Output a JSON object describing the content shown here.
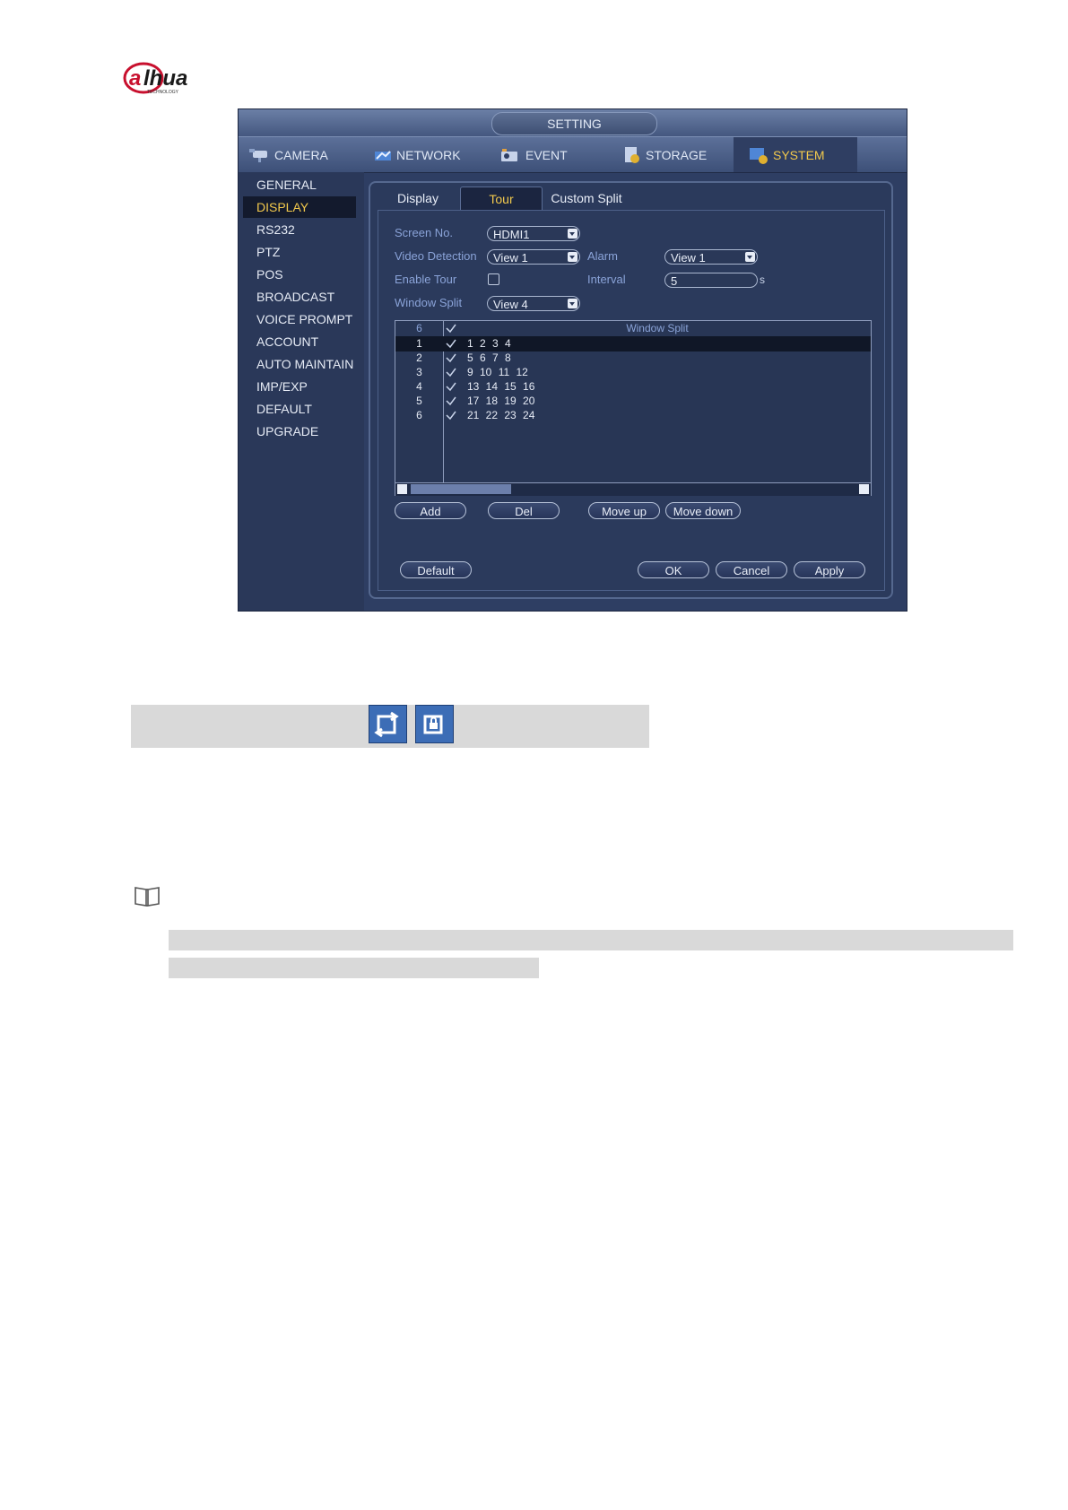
{
  "brand": {
    "name": "alhua",
    "tagline": "TECHNOLOGY",
    "color": "#c8102e"
  },
  "window": {
    "title": "SETTING",
    "nav_tabs": [
      {
        "label": "CAMERA",
        "icon": "camera-icon"
      },
      {
        "label": "NETWORK",
        "icon": "network-icon"
      },
      {
        "label": "EVENT",
        "icon": "event-icon"
      },
      {
        "label": "STORAGE",
        "icon": "storage-icon"
      },
      {
        "label": "SYSTEM",
        "icon": "system-icon",
        "active": true
      }
    ],
    "sidebar": [
      {
        "label": "GENERAL"
      },
      {
        "label": "DISPLAY",
        "active": true
      },
      {
        "label": "RS232"
      },
      {
        "label": "PTZ"
      },
      {
        "label": "POS"
      },
      {
        "label": "BROADCAST"
      },
      {
        "label": "VOICE PROMPT"
      },
      {
        "label": "ACCOUNT"
      },
      {
        "label": "AUTO MAINTAIN"
      },
      {
        "label": "IMP/EXP"
      },
      {
        "label": "DEFAULT"
      },
      {
        "label": "UPGRADE"
      }
    ],
    "sub_tabs": [
      {
        "label": "Display"
      },
      {
        "label": "Tour",
        "active": true
      },
      {
        "label": "Custom Split"
      }
    ],
    "form": {
      "screen_no_label": "Screen No.",
      "screen_no_value": "HDMI1",
      "video_detection_label": "Video Detection",
      "video_detection_value": "View 1",
      "alarm_label": "Alarm",
      "alarm_value": "View 1",
      "enable_tour_label": "Enable Tour",
      "enable_tour_checked": false,
      "interval_label": "Interval",
      "interval_value": "5",
      "interval_unit": "s",
      "window_split_label": "Window Split",
      "window_split_value": "View 4"
    },
    "table": {
      "header_count": "6",
      "header_title": "Window Split",
      "rows": [
        {
          "num": "1",
          "checked": true,
          "value": "1 2 3 4",
          "selected": true
        },
        {
          "num": "2",
          "checked": true,
          "value": "5 6 7 8"
        },
        {
          "num": "3",
          "checked": true,
          "value": "9 10 11 12"
        },
        {
          "num": "4",
          "checked": true,
          "value": "13 14 15 16"
        },
        {
          "num": "5",
          "checked": true,
          "value": "17 18 19 20"
        },
        {
          "num": "6",
          "checked": true,
          "value": "21 22 23 24"
        }
      ]
    },
    "row_buttons": {
      "add": "Add",
      "del": "Del",
      "move_up": "Move up",
      "move_down": "Move down"
    },
    "footer_buttons": {
      "default": "Default",
      "ok": "OK",
      "cancel": "Cancel",
      "apply": "Apply"
    }
  },
  "doc": {
    "toolbar_icons": [
      "tour-start-icon",
      "tour-lock-icon"
    ],
    "note_icon": "book-icon"
  }
}
